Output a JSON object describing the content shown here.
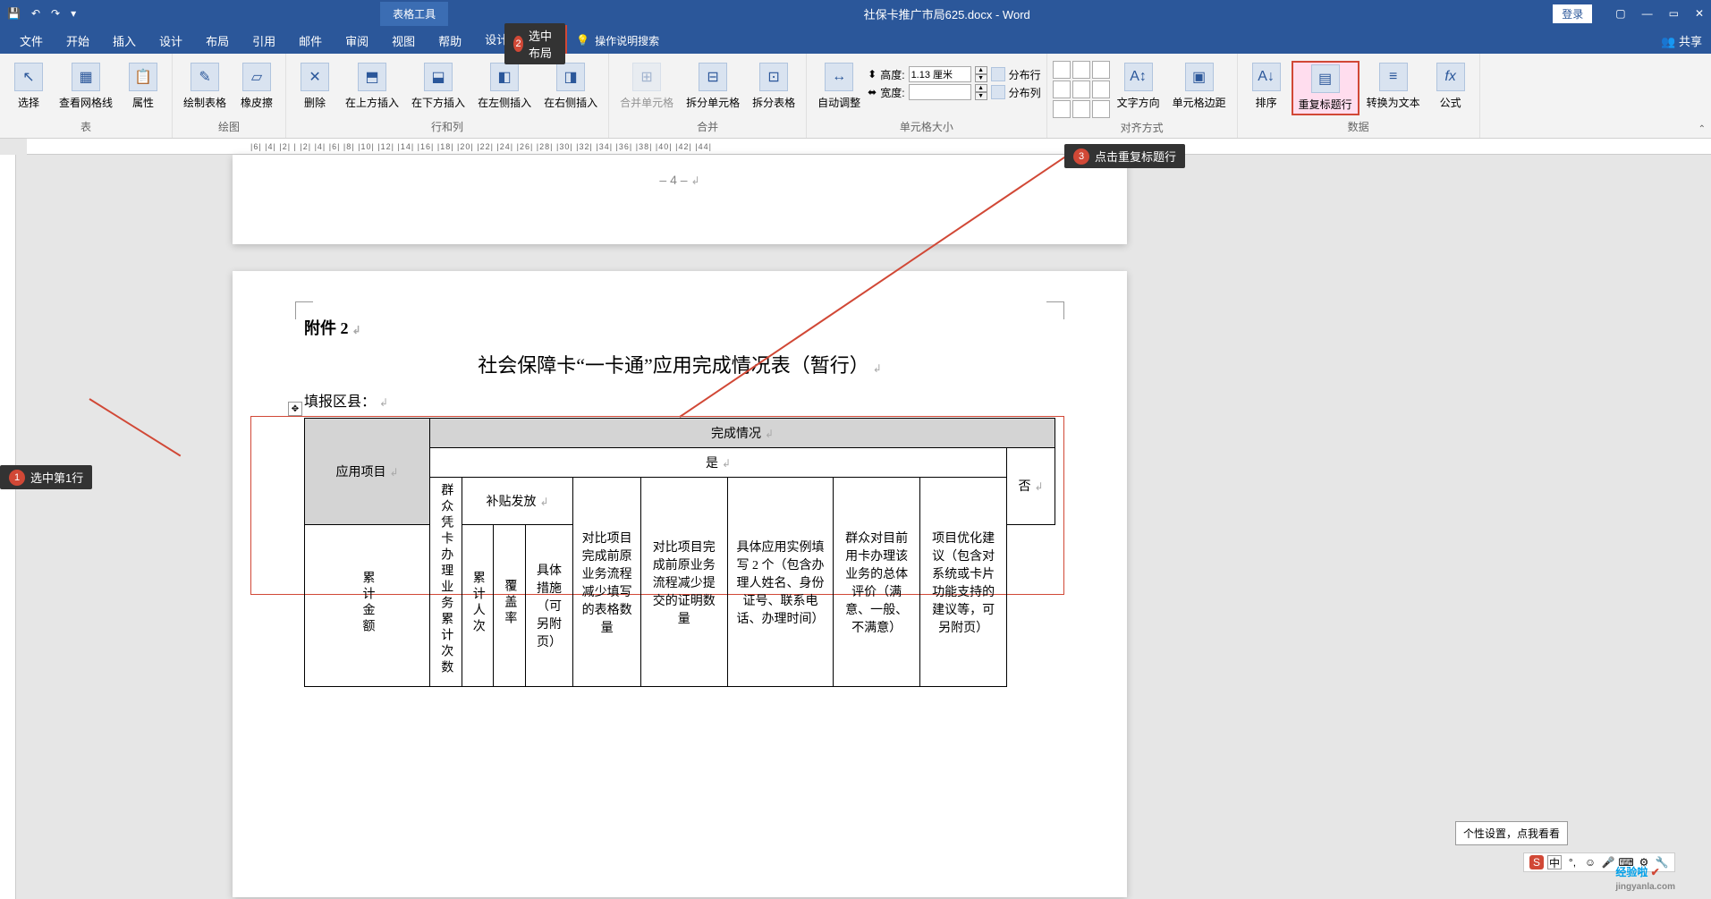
{
  "titlebar": {
    "context_tab": "表格工具",
    "doc_title": "社保卡推广市局625.docx - Word",
    "login": "登录"
  },
  "tabs": {
    "file": "文件",
    "home": "开始",
    "insert": "插入",
    "design": "设计",
    "layout": "布局",
    "references": "引用",
    "mail": "邮件",
    "review": "审阅",
    "view": "视图",
    "help": "帮助",
    "tbl_design": "设计",
    "tbl_layout": "布局",
    "tell_me": "操作说明搜索",
    "share": "共享"
  },
  "callouts": {
    "c1_num": "1",
    "c1": "选中第1行",
    "c2_num": "2",
    "c2": "选中布局",
    "c3_num": "3",
    "c3": "点击重复标题行"
  },
  "ribbon": {
    "g_table": "表",
    "select": "选择",
    "gridlines": "查看网格线",
    "properties": "属性",
    "g_draw": "绘图",
    "draw_table": "绘制表格",
    "eraser": "橡皮擦",
    "g_rowcol": "行和列",
    "delete": "删除",
    "ins_above": "在上方插入",
    "ins_below": "在下方插入",
    "ins_left": "在左侧插入",
    "ins_right": "在右侧插入",
    "g_merge": "合并",
    "merge": "合并单元格",
    "split": "拆分单元格",
    "split_table": "拆分表格",
    "g_size": "单元格大小",
    "autofit": "自动调整",
    "height_lbl": "高度:",
    "width_lbl": "宽度:",
    "height_val": "1.13 厘米",
    "width_val": "",
    "dist_rows": "分布行",
    "dist_cols": "分布列",
    "g_align": "对齐方式",
    "text_dir": "文字方向",
    "cell_margins": "单元格边距",
    "g_data": "数据",
    "sort": "排序",
    "repeat_header": "重复标题行",
    "to_text": "转换为文本",
    "formula": "公式"
  },
  "document": {
    "prev_page_num": "– 4 –",
    "attachment": "附件 2",
    "title": "社会保障卡“一卡通”应用完成情况表（暂行）",
    "fill_county": "填报区县：",
    "hdr_done": "完成情况",
    "hdr_yes": "是",
    "hdr_no": "否",
    "col_app": "应用项目",
    "col1": "群众凭卡办理业务累计次数",
    "col2_top": "补贴发放",
    "col2a": "累计金额",
    "col2b": "累计人次",
    "col2c": "覆盖率",
    "col3": "对比项目完成前原业务流程减少填写的表格数量",
    "col4": "对比项目完成前原业务流程减少提交的证明数量",
    "col5": "具体应用实例填写 2 个（包含办理人姓名、身份证号、联系电话、办理时间）",
    "col6": "群众对目前用卡办理该业务的总体评价（满意、一般、不满意）",
    "col7": "项目优化建议（包含对系统或卡片功能支持的建议等，可另附页）",
    "col8": "具体措施（可另附页）"
  },
  "status": {
    "tip": "个性设置，点我看看",
    "ime_main": "中",
    "watermark": "经验啦",
    "watermark_url": "jingyanla.com"
  },
  "ruler_text": "|6|  |4|  |2|  |  |2|  |4|  |6|  |8|  |10|  |12|  |14|  |16|  |18|  |20|  |22|  |24|  |26|  |28|  |30|  |32|  |34|  |36|  |38|  |40|  |42|  |44|"
}
